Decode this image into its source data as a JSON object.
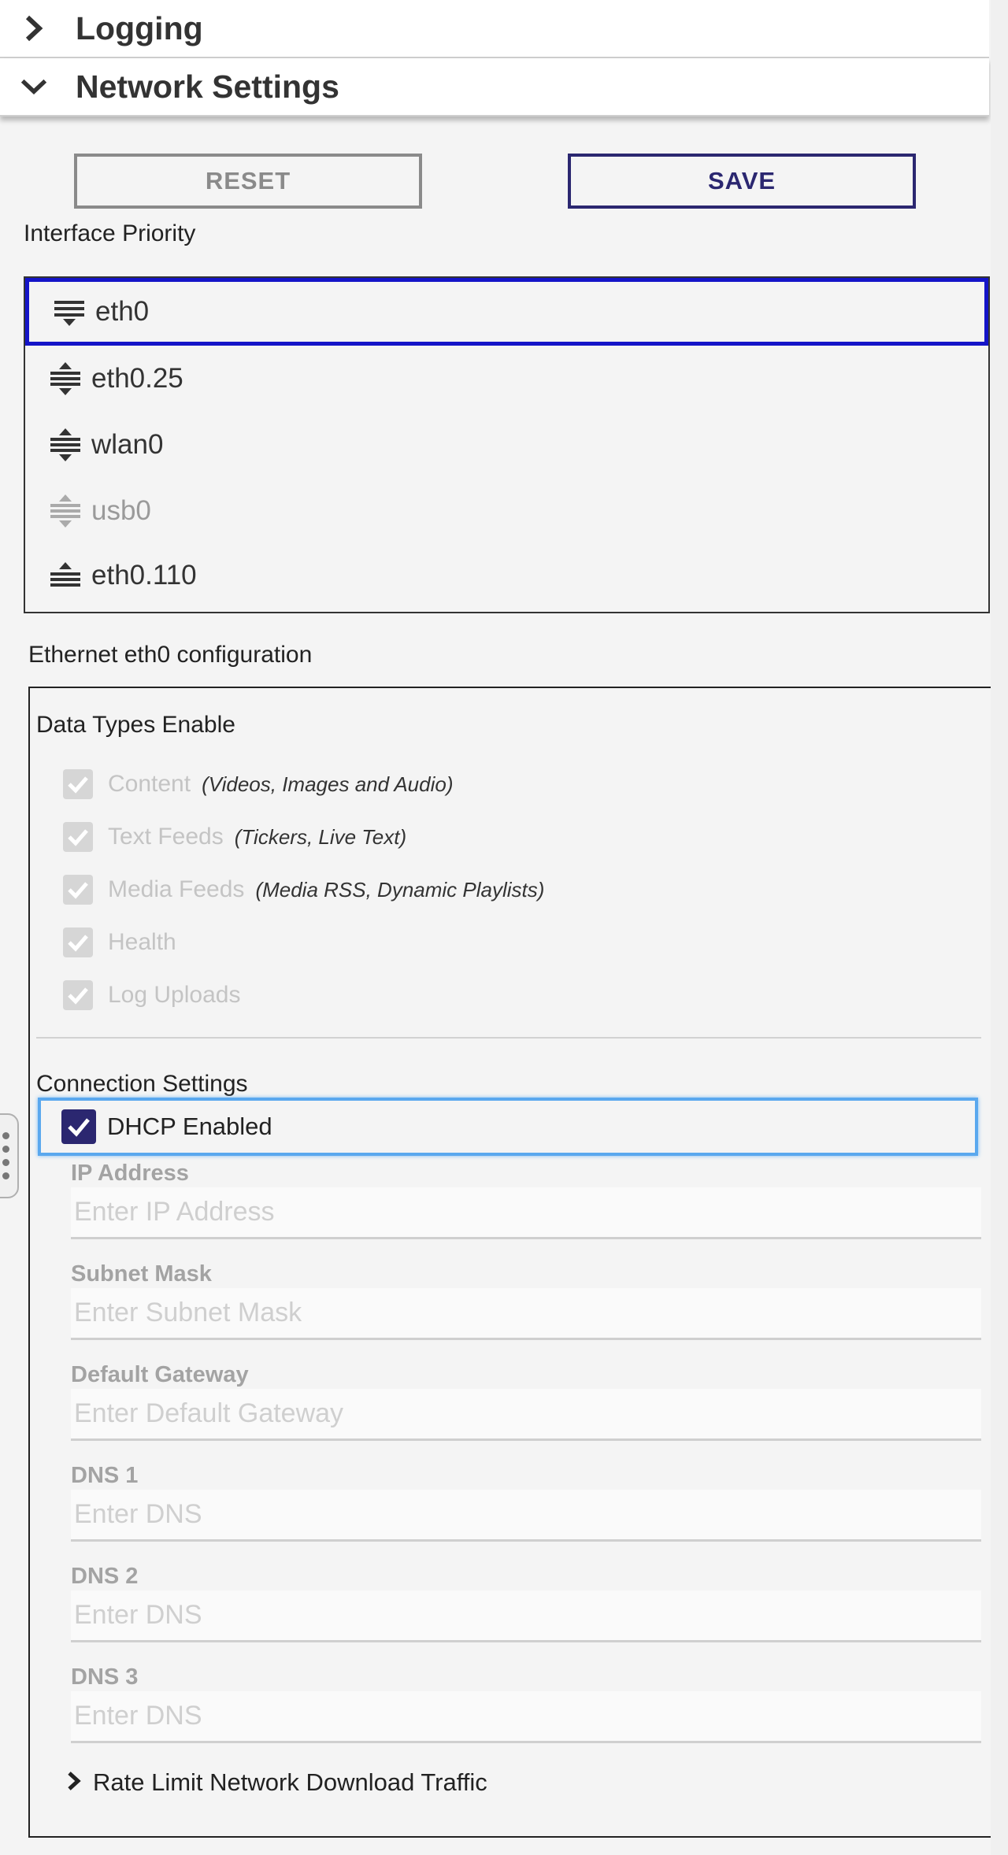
{
  "sections": {
    "logging": "Logging",
    "network": "Network Settings"
  },
  "buttons": {
    "reset": "RESET",
    "save": "SAVE"
  },
  "interface_priority": {
    "label": "Interface Priority",
    "items": [
      {
        "label": "eth0",
        "selected": true,
        "disabled": false
      },
      {
        "label": "eth0.25",
        "selected": false,
        "disabled": false
      },
      {
        "label": "wlan0",
        "selected": false,
        "disabled": false
      },
      {
        "label": "usb0",
        "selected": false,
        "disabled": true
      },
      {
        "label": "eth0.110",
        "selected": false,
        "disabled": false
      }
    ]
  },
  "config": {
    "title": "Ethernet eth0 configuration",
    "data_types": {
      "title": "Data Types Enable",
      "items": [
        {
          "label": "Content",
          "hint": "(Videos, Images and Audio)"
        },
        {
          "label": "Text Feeds",
          "hint": "(Tickers, Live Text)"
        },
        {
          "label": "Media Feeds",
          "hint": "(Media RSS, Dynamic Playlists)"
        },
        {
          "label": "Health",
          "hint": ""
        },
        {
          "label": "Log Uploads",
          "hint": ""
        }
      ]
    },
    "connection": {
      "title": "Connection Settings",
      "dhcp_label": "DHCP Enabled",
      "dhcp_checked": true,
      "fields": [
        {
          "label": "IP Address",
          "placeholder": "Enter IP Address",
          "value": ""
        },
        {
          "label": "Subnet Mask",
          "placeholder": "Enter Subnet Mask",
          "value": ""
        },
        {
          "label": "Default Gateway",
          "placeholder": "Enter Default Gateway",
          "value": ""
        },
        {
          "label": "DNS 1",
          "placeholder": "Enter DNS",
          "value": ""
        },
        {
          "label": "DNS 2",
          "placeholder": "Enter DNS",
          "value": ""
        },
        {
          "label": "DNS 3",
          "placeholder": "Enter DNS",
          "value": ""
        }
      ]
    },
    "rate_limit": "Rate Limit Network Download Traffic"
  },
  "colors": {
    "accent": "#2b2770",
    "focus_blue": "#5aa8ee",
    "selected_border": "#1414c8"
  }
}
